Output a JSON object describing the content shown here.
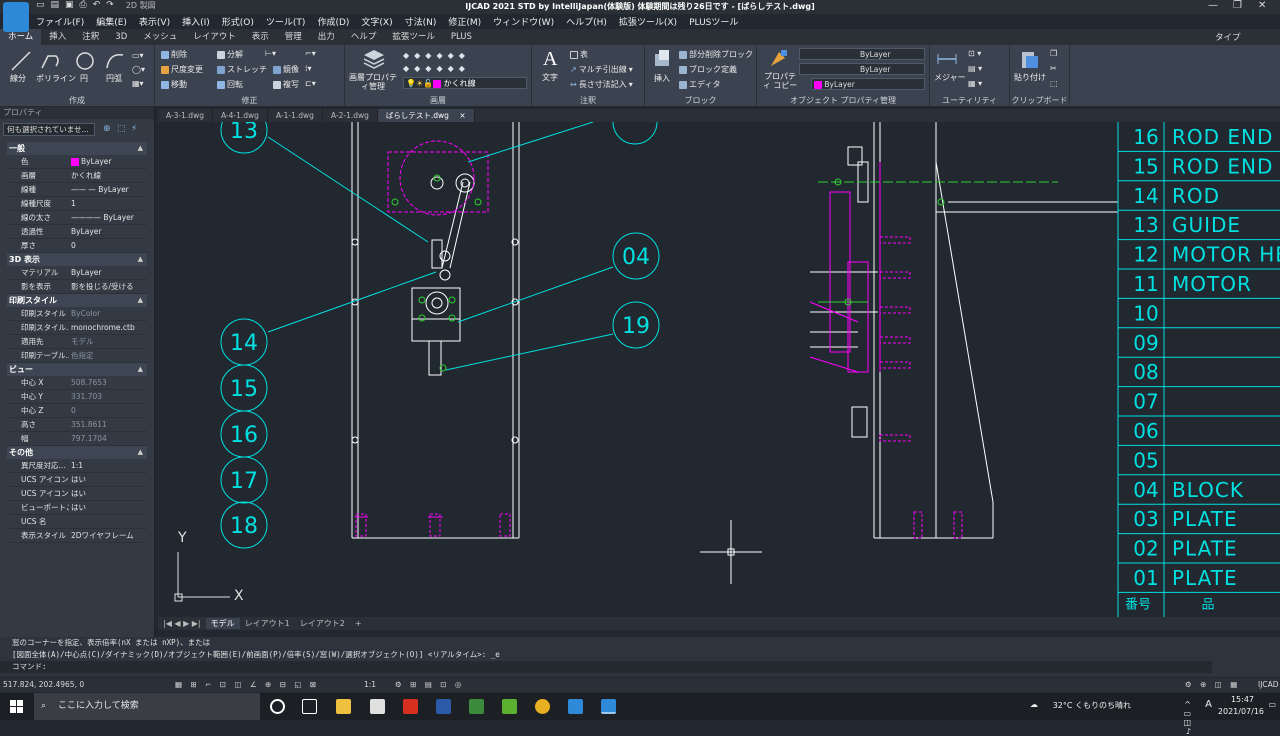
{
  "window": {
    "title": "IJCAD 2021 STD by IntelliJapan(体験版) 体験期間は残り26日です - [ばらしテスト.dwg]",
    "workspace": "2D 製図",
    "search_label": "タイプ"
  },
  "menu": [
    "ファイル(F)",
    "編集(E)",
    "表示(V)",
    "挿入(I)",
    "形式(O)",
    "ツール(T)",
    "作成(D)",
    "文字(X)",
    "寸法(N)",
    "修正(M)",
    "ウィンドウ(W)",
    "ヘルプ(H)",
    "拡張ツール(X)",
    "PLUSツール"
  ],
  "ribbon_tabs": [
    "ホーム",
    "挿入",
    "注釈",
    "3D",
    "メッシュ",
    "レイアウト",
    "表示",
    "管理",
    "出力",
    "ヘルプ",
    "拡張ツール",
    "PLUS"
  ],
  "ribbon": {
    "draw": {
      "title": "作成",
      "items": [
        "線分",
        "ポリライン",
        "円",
        "円弧"
      ]
    },
    "modify": {
      "title": "修正",
      "items": [
        "削除",
        "分解",
        "尺度変更",
        "ストレッチ",
        "鏡像",
        "移動",
        "回転",
        "複写"
      ]
    },
    "layers": {
      "title": "画層",
      "big": "画層プロパティ管理",
      "layer_name": "かくれ線"
    },
    "annotation": {
      "title": "注釈",
      "big": "文字",
      "items": [
        "表",
        "マルチ引出線",
        "長さ寸法記入"
      ]
    },
    "block": {
      "title": "ブロック",
      "big": "挿入",
      "items": [
        "部分削除ブロック",
        "ブロック定義",
        "エディタ"
      ]
    },
    "properties": {
      "title": "オブジェクト プロパティ管理",
      "big": "プロパティ コピー",
      "bylayer": "ByLayer"
    },
    "utility": {
      "title": "ユーティリティ",
      "big": "メジャー"
    },
    "clipboard": {
      "title": "クリップボード",
      "big": "貼り付け"
    }
  },
  "properties_panel": {
    "title": "プロパティ",
    "selection": "何も選択されていませ...",
    "sections": [
      {
        "name": "一般",
        "rows": [
          [
            "色",
            "ByLayer"
          ],
          [
            "画層",
            "かくれ線"
          ],
          [
            "線種",
            "—— — ByLayer"
          ],
          [
            "線種尺度",
            "1"
          ],
          [
            "線の太さ",
            "———— ByLayer"
          ],
          [
            "透過性",
            "ByLayer"
          ],
          [
            "厚さ",
            "0"
          ]
        ]
      },
      {
        "name": "3D 表示",
        "rows": [
          [
            "マテリアル",
            "ByLayer"
          ],
          [
            "影を表示",
            "影を投じる/受ける"
          ]
        ]
      },
      {
        "name": "印刷スタイル",
        "rows": [
          [
            "印刷スタイル",
            "ByColor"
          ],
          [
            "印刷スタイル...",
            "monochrome.ctb"
          ],
          [
            "適用先",
            "モデル"
          ],
          [
            "印刷テーブル...",
            "色指定"
          ]
        ]
      },
      {
        "name": "ビュー",
        "rows": [
          [
            "中心 X",
            "508.7653"
          ],
          [
            "中心 Y",
            "331.703"
          ],
          [
            "中心 Z",
            "0"
          ],
          [
            "高さ",
            "351.8611"
          ],
          [
            "幅",
            "797.1704"
          ]
        ]
      },
      {
        "name": "その他",
        "rows": [
          [
            "異尺度対応...",
            "1:1"
          ],
          [
            "UCS アイコン...",
            "はい"
          ],
          [
            "UCS アイコン...",
            "はい"
          ],
          [
            "ビューポートご...",
            "はい"
          ],
          [
            "UCS 名",
            ""
          ],
          [
            "表示スタイル",
            "2Dワイヤフレーム"
          ]
        ]
      }
    ]
  },
  "doc_tabs": [
    "A-3-1.dwg",
    "A-4-1.dwg",
    "A-1-1.dwg",
    "A-2-1.dwg",
    "ばらしテスト.dwg"
  ],
  "drawing": {
    "balloons_left": [
      "13",
      "14",
      "15",
      "16",
      "17",
      "18"
    ],
    "balloons_mid": [
      "04",
      "19"
    ],
    "ucs": {
      "x": "X",
      "y": "Y"
    },
    "parts_table": [
      {
        "no": "16",
        "name": "ROD END"
      },
      {
        "no": "15",
        "name": "ROD END"
      },
      {
        "no": "14",
        "name": "ROD"
      },
      {
        "no": "13",
        "name": "GUIDE"
      },
      {
        "no": "12",
        "name": "MOTOR HE"
      },
      {
        "no": "11",
        "name": "MOTOR"
      },
      {
        "no": "10",
        "name": ""
      },
      {
        "no": "09",
        "name": ""
      },
      {
        "no": "08",
        "name": ""
      },
      {
        "no": "07",
        "name": ""
      },
      {
        "no": "06",
        "name": ""
      },
      {
        "no": "05",
        "name": ""
      },
      {
        "no": "04",
        "name": "BLOCK"
      },
      {
        "no": "03",
        "name": "PLATE"
      },
      {
        "no": "02",
        "name": "PLATE"
      },
      {
        "no": "01",
        "name": "PLATE"
      }
    ],
    "table_header": {
      "no": "番号",
      "name": "品"
    }
  },
  "layout_tabs": [
    "モデル",
    "レイアウト1",
    "レイアウト2",
    "+"
  ],
  "command": {
    "line1": "窓のコーナーを指定、表示倍率(nX または nXP)、または",
    "line2": "[図面全体(A)/中心点(C)/ダイナミック(D)/オブジェクト範囲(E)/前画面(P)/倍率(S)/窓(W)/選択オブジェクト(O)] <リアルタイム>: _e",
    "prompt": "コマンド:"
  },
  "status": {
    "coords": "517.824, 202.4965, 0",
    "scale": "1:1",
    "app": "IJCAD"
  },
  "taskbar": {
    "search": "ここに入力して検索",
    "weather": "32°C くもりのち晴れ",
    "ime": "A",
    "time": "15:47",
    "date": "2021/07/16"
  }
}
